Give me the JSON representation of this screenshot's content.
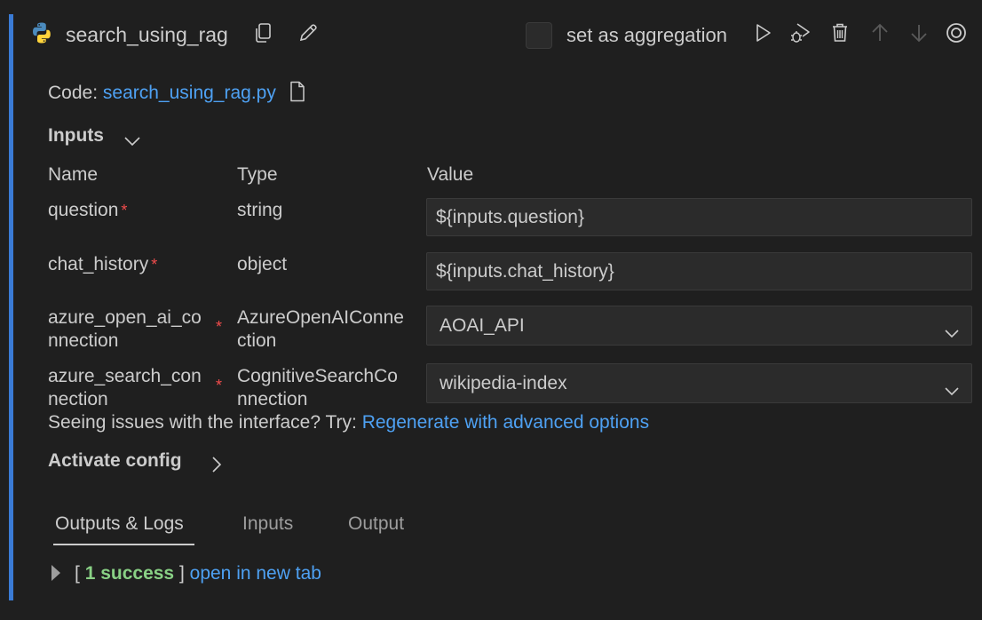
{
  "node": {
    "title": "search_using_rag",
    "aggregation_label": "set as aggregation",
    "aggregation_checked": false
  },
  "code": {
    "label": "Code:",
    "file": "search_using_rag.py"
  },
  "inputs_section": {
    "title": "Inputs",
    "columns": {
      "name": "Name",
      "type": "Type",
      "value": "Value"
    },
    "rows": [
      {
        "name": "question",
        "required": true,
        "type": "string",
        "value": "${inputs.question}"
      },
      {
        "name": "chat_history",
        "required": true,
        "type": "object",
        "value": "${inputs.chat_history}"
      },
      {
        "name_l1": "azure_open_ai_co",
        "name_l2": "nnection",
        "required": true,
        "type_l1": "AzureOpenAIConne",
        "type_l2": "ction",
        "value": "AOAI_API"
      },
      {
        "name_l1": "azure_search_con",
        "name_l2": "nection",
        "required": true,
        "type_l1": "CognitiveSearchCo",
        "type_l2": "nnection",
        "value": "wikipedia-index"
      }
    ]
  },
  "issue": {
    "text": "Seeing issues with the interface? Try:",
    "link": "Regenerate with advanced options"
  },
  "activate_config": {
    "title": "Activate config"
  },
  "tabs": [
    "Outputs & Logs",
    "Inputs",
    "Output"
  ],
  "result": {
    "open_bracket": "[",
    "success": "1 success",
    "close_bracket": "]",
    "link": "open in new tab"
  },
  "colors": {
    "accent": "#3a7bd5",
    "link": "#4ea1f3",
    "required": "#f14c4c",
    "success": "#89d185"
  }
}
